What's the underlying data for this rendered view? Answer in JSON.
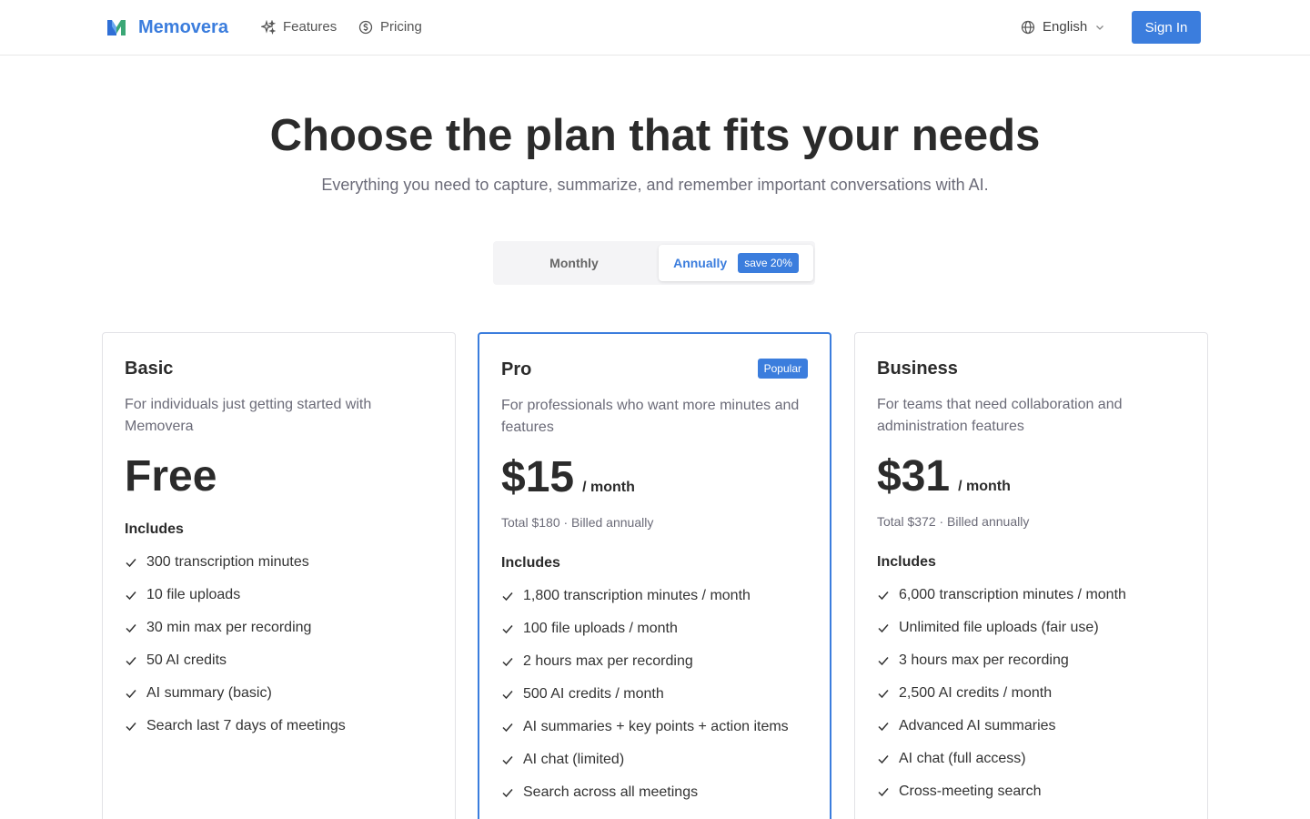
{
  "brand": {
    "name": "Memovera"
  },
  "nav": {
    "items": [
      {
        "label": "Features",
        "icon": "sparkle-icon"
      },
      {
        "label": "Pricing",
        "icon": "dollar-circle-icon"
      }
    ],
    "language": "English",
    "sign_in": "Sign In"
  },
  "hero": {
    "title": "Choose the plan that fits your needs",
    "subtitle": "Everything you need to capture, summarize, and remember important conversations with AI."
  },
  "billing_toggle": {
    "monthly": "Monthly",
    "annually": "Annually",
    "save_badge": "save 20%",
    "selected": "Annually"
  },
  "colors": {
    "accent": "#3b7ddd",
    "text": "#2b2b2b",
    "muted": "#6b6b78"
  },
  "plans": [
    {
      "name": "Basic",
      "description": "For individuals just getting started with Memovera",
      "price": "Free",
      "period": "",
      "billed": "",
      "includes_label": "Includes",
      "features": [
        "300 transcription minutes",
        "10 file uploads",
        "30 min max per recording",
        "50 AI credits",
        "AI summary (basic)",
        "Search last 7 days of meetings"
      ]
    },
    {
      "name": "Pro",
      "badge": "Popular",
      "description": "For professionals who want more minutes and features",
      "price": "$15",
      "period": "/ month",
      "billed": "Total $180 · Billed annually",
      "includes_label": "Includes",
      "features": [
        "1,800 transcription minutes / month",
        "100 file uploads / month",
        "2 hours max per recording",
        "500 AI credits / month",
        "AI summaries + key points + action items",
        "AI chat (limited)",
        "Search across all meetings"
      ]
    },
    {
      "name": "Business",
      "description": "For teams that need collaboration and administration features",
      "price": "$31",
      "period": "/ month",
      "billed": "Total $372 · Billed annually",
      "includes_label": "Includes",
      "features": [
        "6,000 transcription minutes / month",
        "Unlimited file uploads (fair use)",
        "3 hours max per recording",
        "2,500 AI credits / month",
        "Advanced AI summaries",
        "AI chat (full access)",
        "Cross-meeting search"
      ]
    }
  ]
}
